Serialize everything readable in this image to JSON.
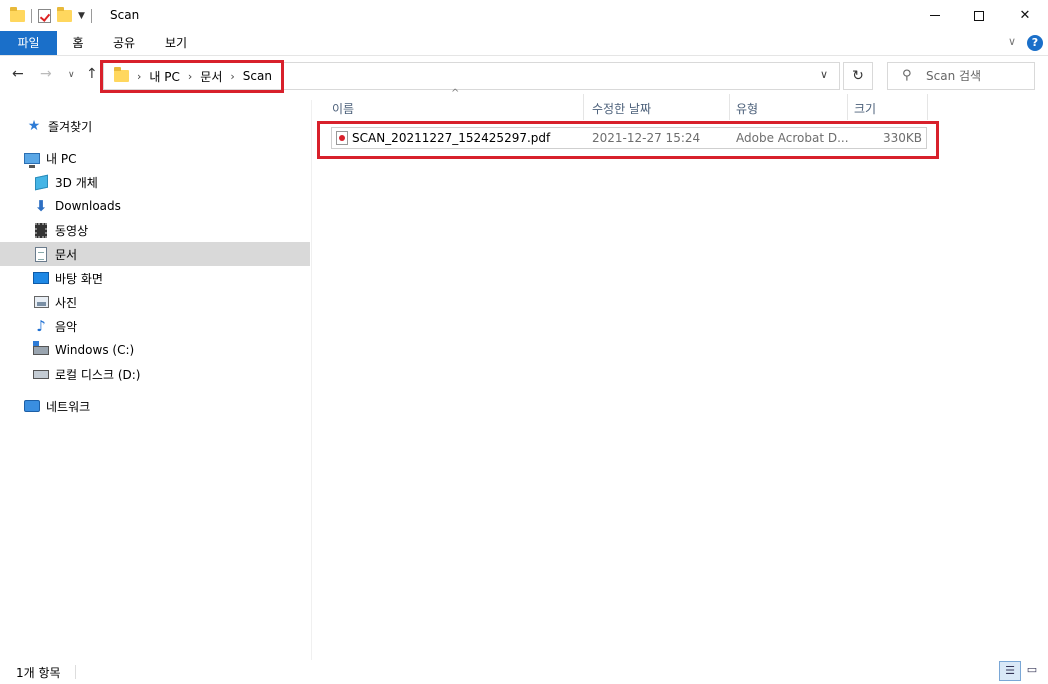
{
  "window": {
    "title": "Scan",
    "close_glyph": "✕"
  },
  "ribbon": {
    "tabs": [
      "파일",
      "홈",
      "공유",
      "보기"
    ],
    "help_glyph": "?"
  },
  "navigation": {
    "breadcrumbs": [
      "내 PC",
      "문서",
      "Scan"
    ],
    "search_placeholder": "Scan 검색"
  },
  "sidebar": {
    "items": [
      {
        "label": "즐겨찾기",
        "icon": "star-icon"
      },
      {
        "label": "내 PC",
        "icon": "computer-icon"
      },
      {
        "label": "3D 개체",
        "icon": "cube-icon"
      },
      {
        "label": "Downloads",
        "icon": "download-arrow-icon"
      },
      {
        "label": "동영상",
        "icon": "film-icon"
      },
      {
        "label": "문서",
        "icon": "document-icon",
        "selected": true
      },
      {
        "label": "바탕 화면",
        "icon": "desktop-icon"
      },
      {
        "label": "사진",
        "icon": "picture-icon"
      },
      {
        "label": "음악",
        "icon": "music-note-icon"
      },
      {
        "label": "Windows (C:)",
        "icon": "system-drive-icon"
      },
      {
        "label": "로컬 디스크 (D:)",
        "icon": "drive-icon"
      },
      {
        "label": "네트워크",
        "icon": "network-icon"
      }
    ]
  },
  "file_list": {
    "columns": {
      "name": "이름",
      "date": "수정한 날짜",
      "type": "유형",
      "size": "크기"
    },
    "rows": [
      {
        "name": "SCAN_20211227_152425297.pdf",
        "date": "2021-12-27 15:24",
        "type": "Adobe Acrobat D...",
        "size": "330KB",
        "icon": "pdf-file-icon"
      }
    ]
  },
  "status": {
    "item_count": "1개 항목"
  },
  "colors": {
    "accent": "#1a6fc9",
    "highlight_box": "#d8202b",
    "selected_nav": "#d9d9d9"
  }
}
